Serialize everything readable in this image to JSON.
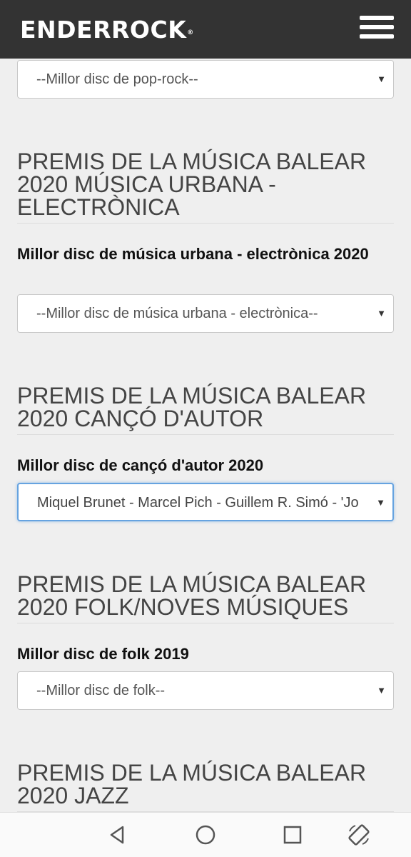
{
  "header": {
    "logo": "ENDERROCK",
    "logo_mark": "®",
    "menu_icon": "hamburger-menu-icon"
  },
  "top_select": {
    "value": "--Millor disc de pop-rock--"
  },
  "sections": [
    {
      "title": "PREMIS DE LA MÚSICA BALEAR 2020 MÚSICA URBANA - ELECTRÒNICA",
      "label": "Millor disc de música urbana - electrònica 2020",
      "value": "--Millor disc de música urbana - electrònica--"
    },
    {
      "title": "PREMIS DE LA MÚSICA BALEAR 2020 CANÇÓ D'AUTOR",
      "label": "Millor disc de cançó d'autor 2020",
      "value": "Miquel Brunet - Marcel Pich - Guillem R. Simó - 'Jo"
    },
    {
      "title": "PREMIS DE LA MÚSICA BALEAR 2020 FOLK/NOVES MÚSIQUES",
      "label": "Millor disc de folk 2019",
      "value": "--Millor disc de folk--"
    },
    {
      "title": "PREMIS DE LA MÚSICA BALEAR 2020 JAZZ"
    }
  ],
  "dropdown_arrow": "▼",
  "navbar": {
    "icons": [
      "back-icon",
      "home-icon",
      "recents-icon",
      "rotate-icon"
    ]
  },
  "colors": {
    "header_bg": "#333333",
    "page_bg": "#efefef",
    "focus_border": "#66a3e0"
  }
}
